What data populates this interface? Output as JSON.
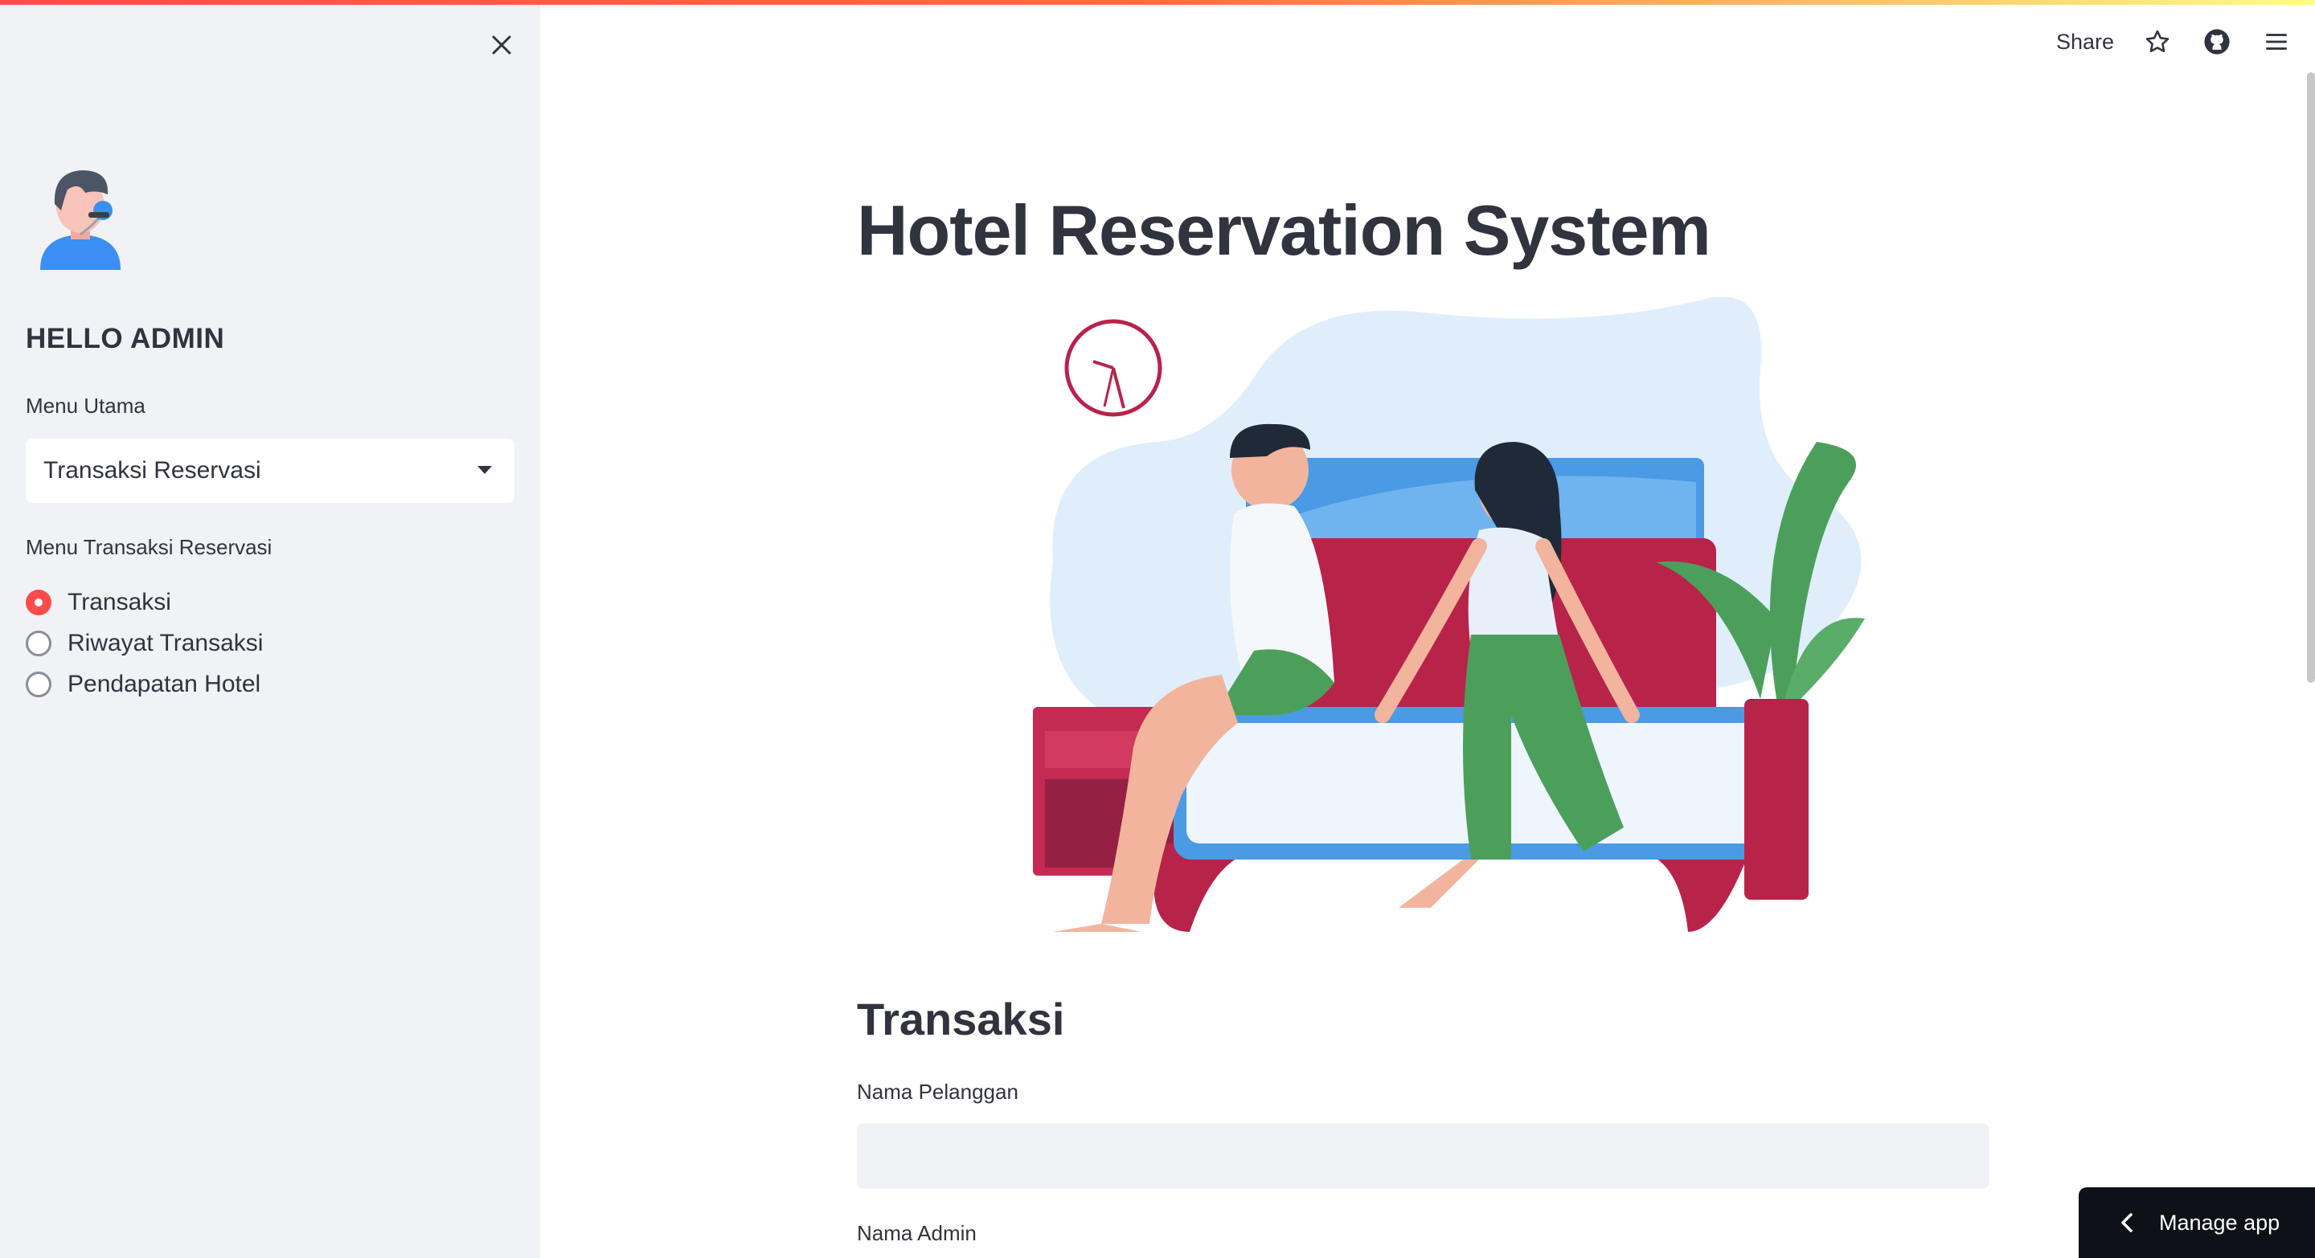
{
  "colors": {
    "accent": "#ff4b4b",
    "sidebar_bg": "#f0f2f6",
    "text": "#31333f"
  },
  "sidebar": {
    "close_icon": "close-icon",
    "avatar_icon": "admin-avatar",
    "greeting": "HELLO ADMIN",
    "main_menu_label": "Menu Utama",
    "main_menu_selected": "Transaksi Reservasi",
    "sub_menu_label": "Menu Transaksi Reservasi",
    "sub_menu_options": [
      {
        "label": "Transaksi",
        "selected": true
      },
      {
        "label": "Riwayat Transaksi",
        "selected": false
      },
      {
        "label": "Pendapatan Hotel",
        "selected": false
      }
    ]
  },
  "toolbar": {
    "share_label": "Share",
    "icons": [
      "star-icon",
      "github-icon",
      "hamburger-menu-icon"
    ]
  },
  "main": {
    "title": "Hotel Reservation System",
    "hero_image": "couple-on-bed-illustration",
    "section_title": "Transaksi",
    "fields": [
      {
        "label": "Nama Pelanggan",
        "value": ""
      },
      {
        "label": "Nama Admin",
        "value": ""
      }
    ]
  },
  "manage_app": {
    "label": "Manage app",
    "icon": "chevron-left-icon"
  }
}
